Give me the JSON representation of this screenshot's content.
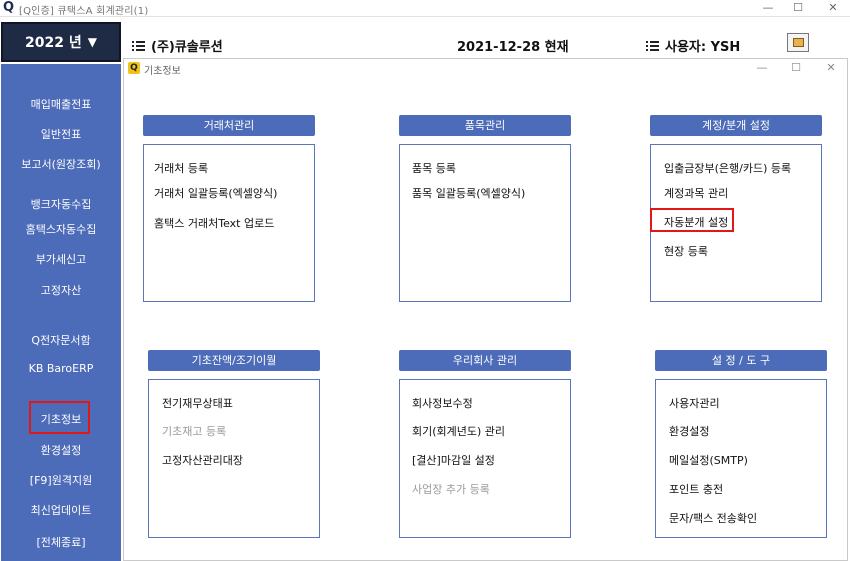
{
  "titlebar": {
    "logo": "Q",
    "title": "[Q인증] 큐택스A   회계관리(1)",
    "min_glyph": "—",
    "max_glyph": "☐",
    "close_glyph": "✕"
  },
  "year": {
    "label": "2022 년",
    "caret": "▼"
  },
  "header": {
    "company": "(주)큐솔루션",
    "date": "2021-12-28 현재",
    "user": "사용자: YSH"
  },
  "sidebar": {
    "items": [
      "매입매출전표",
      "일반전표",
      "보고서(원장조회)",
      "뱅크자동수집",
      "홈택스자동수집",
      "부가세신고",
      "고정자산",
      "Q전자문서함",
      "KB BaroERP",
      "기초정보",
      "환경설정",
      "[F9]원격지원",
      "최신업데이트",
      "[전체종료]"
    ]
  },
  "inner_window": {
    "logo": "Q",
    "title": "기초정보",
    "min_glyph": "—",
    "max_glyph": "☐",
    "close_glyph": "✕"
  },
  "sections": [
    {
      "title": "거래처관리",
      "items": [
        {
          "label": "거래처 등록",
          "enabled": true
        },
        {
          "label": "거래처 일괄등록(엑셀양식)",
          "enabled": true
        },
        {
          "label": "홈택스 거래처Text 업로드",
          "enabled": true
        }
      ]
    },
    {
      "title": "품목관리",
      "items": [
        {
          "label": "품목 등록",
          "enabled": true
        },
        {
          "label": "품목 일괄등록(엑셀양식)",
          "enabled": true
        }
      ]
    },
    {
      "title": "계정/분개 설정",
      "items": [
        {
          "label": "입출금장부(은행/카드) 등록",
          "enabled": true
        },
        {
          "label": "계정과목 관리",
          "enabled": true
        },
        {
          "label": "자동분개 설정",
          "enabled": true
        },
        {
          "label": "현장 등록",
          "enabled": true
        }
      ]
    },
    {
      "title": "기초잔액/조기이월",
      "items": [
        {
          "label": "전기재무상태표",
          "enabled": true
        },
        {
          "label": "기초재고 등록",
          "enabled": false
        },
        {
          "label": "고정자산관리대장",
          "enabled": true
        }
      ]
    },
    {
      "title": "우리회사 관리",
      "items": [
        {
          "label": "회사정보수정",
          "enabled": true
        },
        {
          "label": "회기(회계년도) 관리",
          "enabled": true
        },
        {
          "label": "[결산]마감일 설정",
          "enabled": true
        },
        {
          "label": "사업장 추가 등록",
          "enabled": false
        }
      ]
    },
    {
      "title": "설 정 / 도 구",
      "items": [
        {
          "label": "사용자관리",
          "enabled": true
        },
        {
          "label": "환경설정",
          "enabled": true
        },
        {
          "label": "메일설정(SMTP)",
          "enabled": true
        },
        {
          "label": "포인트 충전",
          "enabled": true
        },
        {
          "label": "문자/팩스 전송확인",
          "enabled": true
        }
      ]
    }
  ]
}
